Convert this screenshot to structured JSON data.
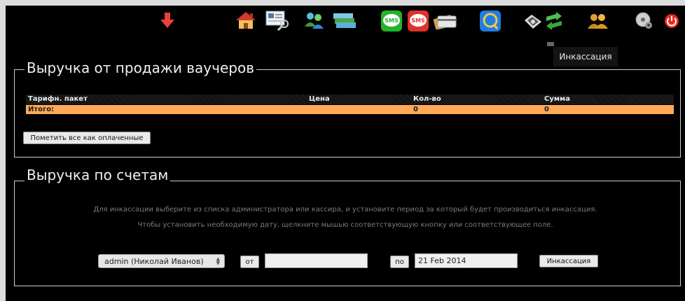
{
  "toolbar": {
    "icons": [
      "arrow-down-icon",
      "home-icon",
      "document-search-icon",
      "users-icon",
      "cards-stack-icon",
      "sms-green-icon",
      "sms-red-icon",
      "credit-card-icon",
      "browser-icon",
      "gear-tools-icon",
      "money-transfer-icon",
      "group-icon",
      "settings-disc-icon",
      "power-icon"
    ],
    "tooltip": "Инкассация",
    "sms_label": "SMS"
  },
  "voucher_section": {
    "title": "Выручка от продажи ваучеров",
    "columns": [
      "Тарифн. пакет",
      "Цена",
      "Кол-во",
      "Сумма"
    ],
    "total_row": {
      "label": "Итого:",
      "price": "",
      "count": "0",
      "sum": "0"
    },
    "mark_paid_button": "Пометить все как оплаченные"
  },
  "accounts_section": {
    "title": "Выручка по счетам",
    "info_line_1": "Для инкассации выберите из списка администратора или кассира, и установите период за который будет производиться инкассация.",
    "info_line_2": "Чтобы установить необходимую дату, щелкните мышью соответствующую кнопку или соответствующее поле.",
    "admin_select": "admin (Николай Иванов)",
    "from_label": "от",
    "from_date": "",
    "to_label": "по",
    "to_date": "21 Feb 2014",
    "collect_button": "Инкассация"
  },
  "colors": {
    "total_row": "#ffa858",
    "background": "#000000"
  }
}
